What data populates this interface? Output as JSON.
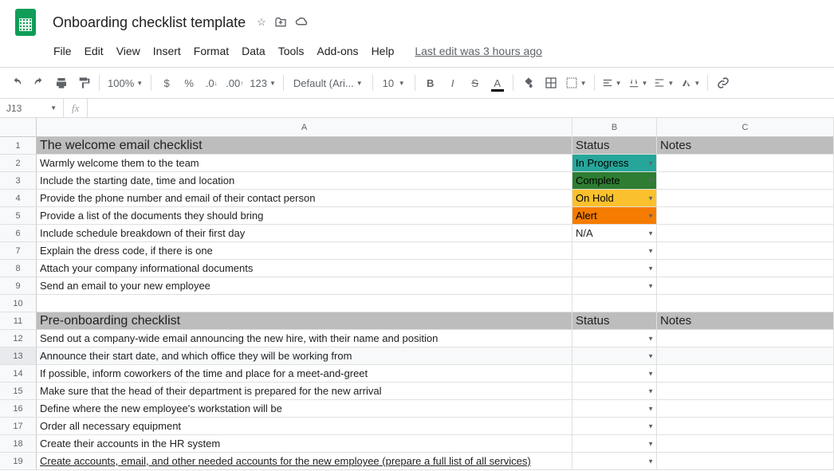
{
  "doc": {
    "title": "Onboarding checklist template",
    "last_edit": "Last edit was 3 hours ago"
  },
  "menu": {
    "file": "File",
    "edit": "Edit",
    "view": "View",
    "insert": "Insert",
    "format": "Format",
    "data": "Data",
    "tools": "Tools",
    "addons": "Add-ons",
    "help": "Help"
  },
  "toolbar": {
    "zoom": "100%",
    "font": "Default (Ari...",
    "size": "10",
    "fmt123": "123"
  },
  "formula": {
    "cell": "J13",
    "fx": "fx"
  },
  "cols": {
    "A": "A",
    "B": "B",
    "C": "C"
  },
  "headers": {
    "status": "Status",
    "notes": "Notes"
  },
  "sections": {
    "s1": "The welcome email checklist",
    "s2": "Pre-onboarding checklist"
  },
  "rows": {
    "r2": "Warmly welcome them to the team",
    "r3": "Include the starting date, time and location",
    "r4": "Provide the phone number and email of their contact person",
    "r5": "Provide a list of the documents they should bring",
    "r6": "Include schedule breakdown of their first day",
    "r7": "Explain the dress code, if there is one",
    "r8": "Attach your company informational documents",
    "r9": "Send an email to your new employee",
    "r12": "Send out a company-wide email announcing the new hire, with their name and position",
    "r13": "Announce their start date, and which office they will be working from",
    "r14": "If possible, inform coworkers of the time and place for a meet-and-greet",
    "r15": "Make sure that the head of their department is prepared for the new arrival",
    "r16": "Define where the new employee's workstation will be",
    "r17": "Order all necessary equipment",
    "r18": "Create their accounts in the HR system",
    "r19": "Create accounts, email, and other needed accounts for the new employee (prepare a full list of all services)"
  },
  "status": {
    "r2": "In Progress",
    "r3": "Complete",
    "r4": "On Hold",
    "r5": "Alert",
    "r6": "N/A"
  },
  "nums": {
    "1": "1",
    "2": "2",
    "3": "3",
    "4": "4",
    "5": "5",
    "6": "6",
    "7": "7",
    "8": "8",
    "9": "9",
    "10": "10",
    "11": "11",
    "12": "12",
    "13": "13",
    "14": "14",
    "15": "15",
    "16": "16",
    "17": "17",
    "18": "18",
    "19": "19"
  }
}
